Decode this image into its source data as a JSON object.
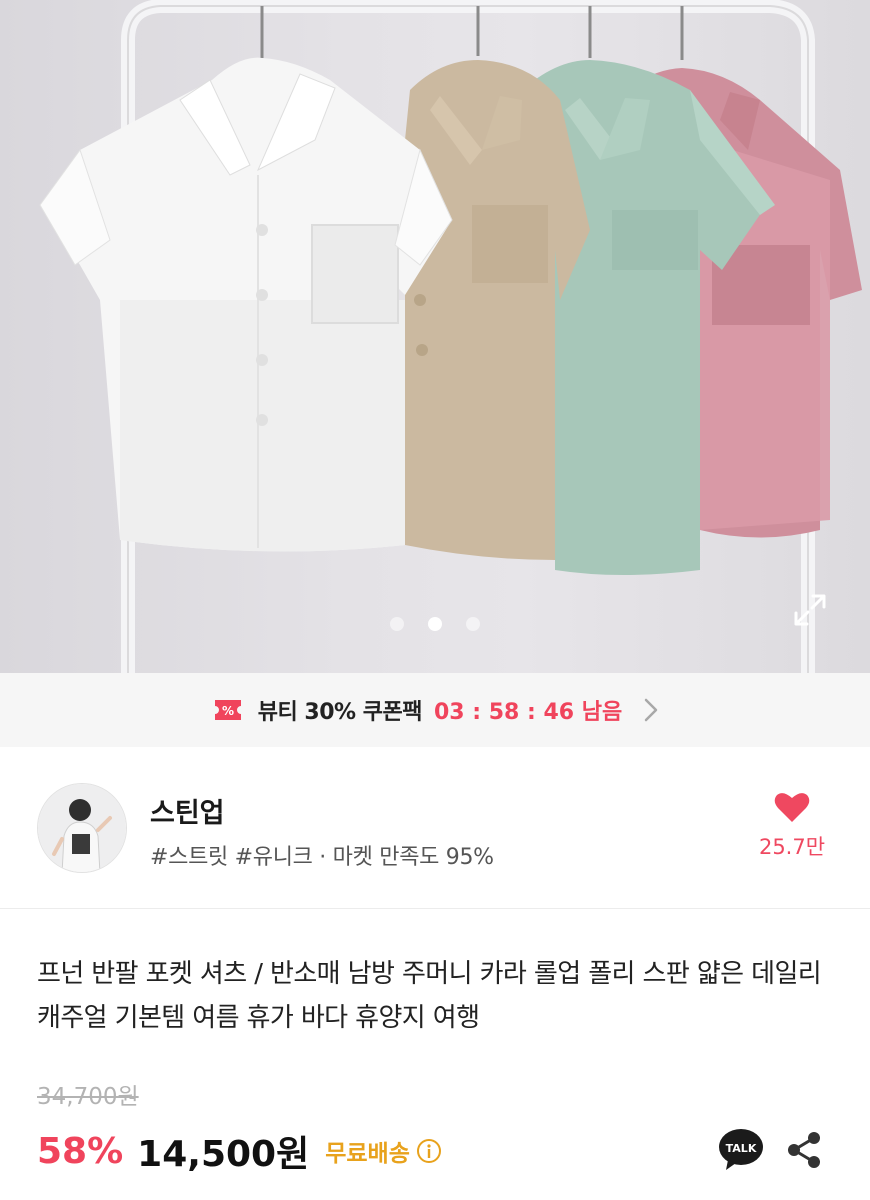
{
  "gallery": {
    "image_description_icon": "shirt-product-photo",
    "current_index": 2,
    "total": 3,
    "expand_icon": "expand-icon"
  },
  "coupon": {
    "icon": "coupon-ticket-icon",
    "text": "뷰티 30% 쿠폰팩",
    "timer": "03 : 58 : 46 남음",
    "accent_color": "#f0445c"
  },
  "seller": {
    "name": "스틴업",
    "tags": "#스트릿 #유니크 · 마켓 만족도 95%",
    "avatar_icon": "seller-avatar",
    "likes": "25.7만",
    "like_icon": "heart-icon"
  },
  "product": {
    "title": "프넌 반팔 포켓 셔츠 / 반소매 남방 주머니 카라 롤업 폴리 스판 얇은 데일리 캐주얼 기본템 여름 휴가 바다 휴양지 여행",
    "original_price": "34,700원",
    "discount": "58%",
    "price": "14,500원",
    "shipping": "무료배송",
    "talk_label": "TALK"
  }
}
